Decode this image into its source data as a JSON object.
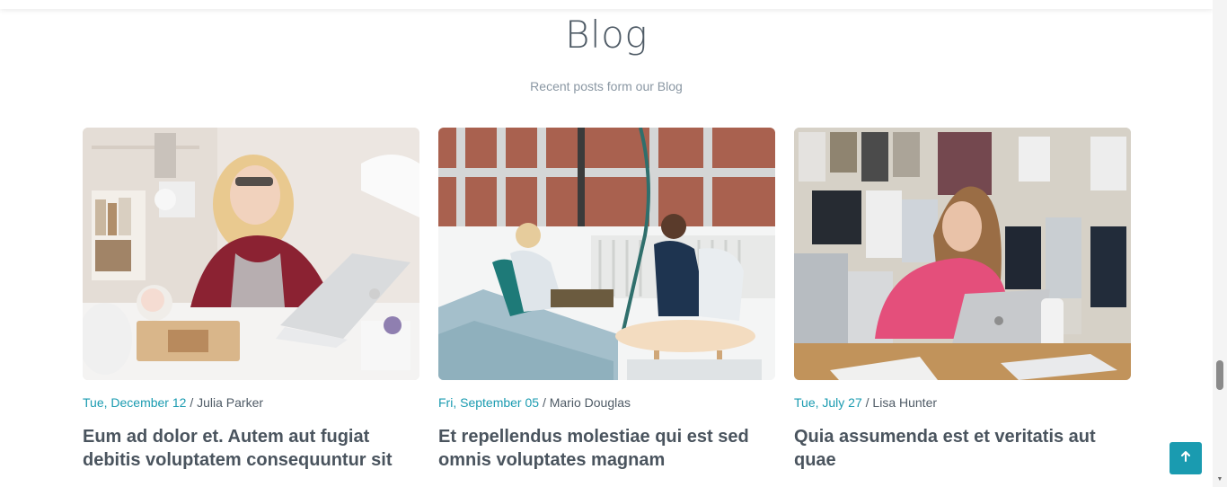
{
  "section": {
    "title": "Blog",
    "subtitle": "Recent posts form our Blog"
  },
  "posts": [
    {
      "date": "Tue, December 12",
      "separator": " / ",
      "author": "Julia Parker",
      "title": "Eum ad dolor et. Autem aut fugiat debitis voluptatem consequuntur sit"
    },
    {
      "date": "Fri, September 05",
      "separator": " / ",
      "author": "Mario Douglas",
      "title": "Et repellendus molestiae qui est sed omnis voluptates magnam"
    },
    {
      "date": "Tue, July 27",
      "separator": " / ",
      "author": "Lisa Hunter",
      "title": "Quia assumenda est et veritatis aut quae"
    }
  ],
  "colors": {
    "accent": "#1a9bb0",
    "heading": "#4a545e",
    "muted": "#8a97a3"
  },
  "icons": {
    "back_to_top": "arrow-up-icon"
  }
}
